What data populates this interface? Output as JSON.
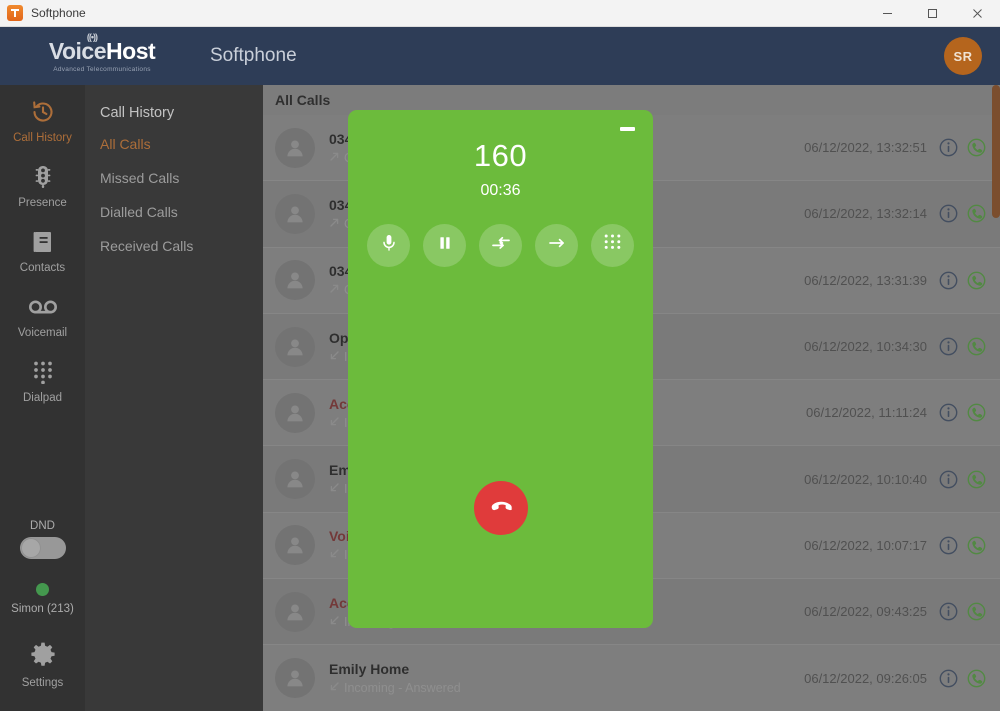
{
  "window": {
    "title": "Softphone",
    "app_icon": "app-icon",
    "controls": [
      {
        "name": "minimize",
        "glyph": "—"
      },
      {
        "name": "maximize",
        "glyph": "□"
      },
      {
        "name": "close",
        "glyph": "✕"
      }
    ]
  },
  "header": {
    "logo_prefix": "V",
    "logo_o": "o",
    "logo_mid": "ice",
    "logo_suffix": "Host",
    "logo_tagline": "Advanced Telecommunications",
    "app_name": "Softphone",
    "avatar_initials": "SR",
    "brand_navy": "#2e3d57",
    "accent_orange": "#d2772c"
  },
  "rail": {
    "items": [
      {
        "label": "Call History",
        "icon": "history-icon",
        "active": true
      },
      {
        "label": "Presence",
        "icon": "traffic-light-icon",
        "active": false
      },
      {
        "label": "Contacts",
        "icon": "contacts-book-icon",
        "active": false
      },
      {
        "label": "Voicemail",
        "icon": "voicemail-icon",
        "active": false
      },
      {
        "label": "Dialpad",
        "icon": "dialpad-icon",
        "active": false
      }
    ],
    "dnd_label": "DND",
    "dnd_enabled": false,
    "presence_name": "Simon (213)",
    "presence_color": "#3cb44a",
    "settings_label": "Settings"
  },
  "subnav": {
    "title": "Call History",
    "items": [
      {
        "label": "All Calls",
        "active": true
      },
      {
        "label": "Missed Calls",
        "active": false
      },
      {
        "label": "Dialled Calls",
        "active": false
      },
      {
        "label": "Received Calls",
        "active": false
      }
    ]
  },
  "list": {
    "header": "All Calls",
    "rows": [
      {
        "name": "034",
        "direction": "outgoing",
        "status": "Outgoing",
        "time": "06/12/2022, 13:32:51",
        "missed": false
      },
      {
        "name": "034",
        "direction": "outgoing",
        "status": "Outgoing",
        "time": "06/12/2022, 13:32:14",
        "missed": false
      },
      {
        "name": "034",
        "direction": "outgoing",
        "status": "Outgoing",
        "time": "06/12/2022, 13:31:39",
        "missed": false
      },
      {
        "name": "Op",
        "direction": "incoming",
        "status": "Incoming",
        "time": "06/12/2022, 10:34:30",
        "missed": false
      },
      {
        "name": "Acc",
        "direction": "incoming",
        "status": "Incoming",
        "time": "06/12/2022, 11:11:24",
        "missed": true
      },
      {
        "name": "Em",
        "direction": "incoming",
        "status": "Incoming",
        "time": "06/12/2022, 10:10:40",
        "missed": false
      },
      {
        "name": "Voi",
        "direction": "incoming",
        "status": "Incoming",
        "time": "06/12/2022, 10:07:17",
        "missed": true
      },
      {
        "name": "Acc",
        "direction": "incoming",
        "status": "Incoming - Missed",
        "time": "06/12/2022, 09:43:25",
        "missed": true
      },
      {
        "name": "Emily Home",
        "direction": "incoming",
        "status": "Incoming - Answered",
        "time": "06/12/2022, 09:26:05",
        "missed": false
      }
    ],
    "info_icon": "info-icon",
    "call_icon": "call-back-icon",
    "scrollbar_color": "#8a4a1c"
  },
  "call_panel": {
    "number": "160",
    "duration": "00:36",
    "background": "#6cbb3c",
    "minimize_label": "minimize-call-panel",
    "controls": [
      {
        "name": "mute-button",
        "icon": "microphone-icon"
      },
      {
        "name": "hold-button",
        "icon": "pause-icon"
      },
      {
        "name": "attended-transfer-button",
        "icon": "attended-transfer-icon"
      },
      {
        "name": "blind-transfer-button",
        "icon": "arrow-right-icon"
      },
      {
        "name": "keypad-button",
        "icon": "dialpad-icon"
      }
    ],
    "hangup": {
      "name": "hangup-button",
      "icon": "hangup-phone-icon",
      "color": "#e03b3b"
    }
  }
}
